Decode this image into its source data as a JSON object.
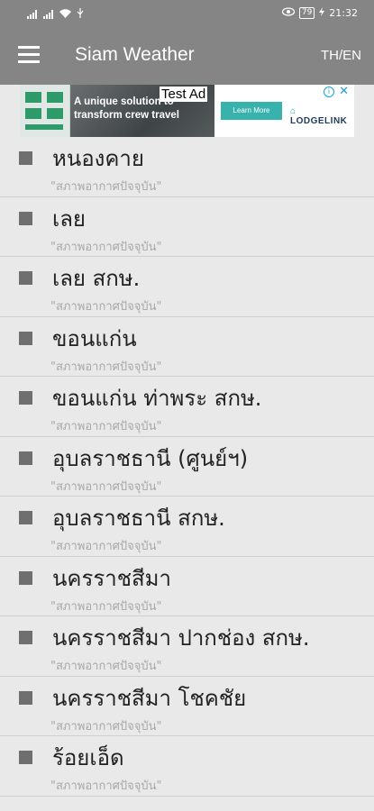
{
  "status_bar": {
    "time": "21:32",
    "battery": "79"
  },
  "app_bar": {
    "title": "Siam Weather",
    "language_toggle": "TH/EN"
  },
  "ad": {
    "label": "Test Ad",
    "headline": "A unique solution to transform crew travel",
    "cta": "Learn More",
    "brand": "LODGELINK"
  },
  "stations": [
    {
      "name": "หนองคาย",
      "subtitle": "\"สภาพอากาศปัจจุบัน\""
    },
    {
      "name": "เลย",
      "subtitle": "\"สภาพอากาศปัจจุบัน\""
    },
    {
      "name": "เลย สกษ.",
      "subtitle": "\"สภาพอากาศปัจจุบัน\""
    },
    {
      "name": "ขอนแก่น",
      "subtitle": "\"สภาพอากาศปัจจุบัน\""
    },
    {
      "name": "ขอนแก่น ท่าพระ สกษ.",
      "subtitle": "\"สภาพอากาศปัจจุบัน\""
    },
    {
      "name": "อุบลราชธานี (ศูนย์ฯ)",
      "subtitle": "\"สภาพอากาศปัจจุบัน\""
    },
    {
      "name": "อุบลราชธานี สกษ.",
      "subtitle": "\"สภาพอากาศปัจจุบัน\""
    },
    {
      "name": "นครราชสีมา",
      "subtitle": "\"สภาพอากาศปัจจุบัน\""
    },
    {
      "name": "นครราชสีมา ปากช่อง สกษ.",
      "subtitle": "\"สภาพอากาศปัจจุบัน\""
    },
    {
      "name": "นครราชสีมา โชคชัย",
      "subtitle": "\"สภาพอากาศปัจจุบัน\""
    },
    {
      "name": "ร้อยเอ็ด",
      "subtitle": "\"สภาพอากาศปัจจุบัน\""
    }
  ],
  "colors": {
    "app_bar": "#858585",
    "background": "#e9e9e9",
    "bullet": "#6f6f6f"
  }
}
